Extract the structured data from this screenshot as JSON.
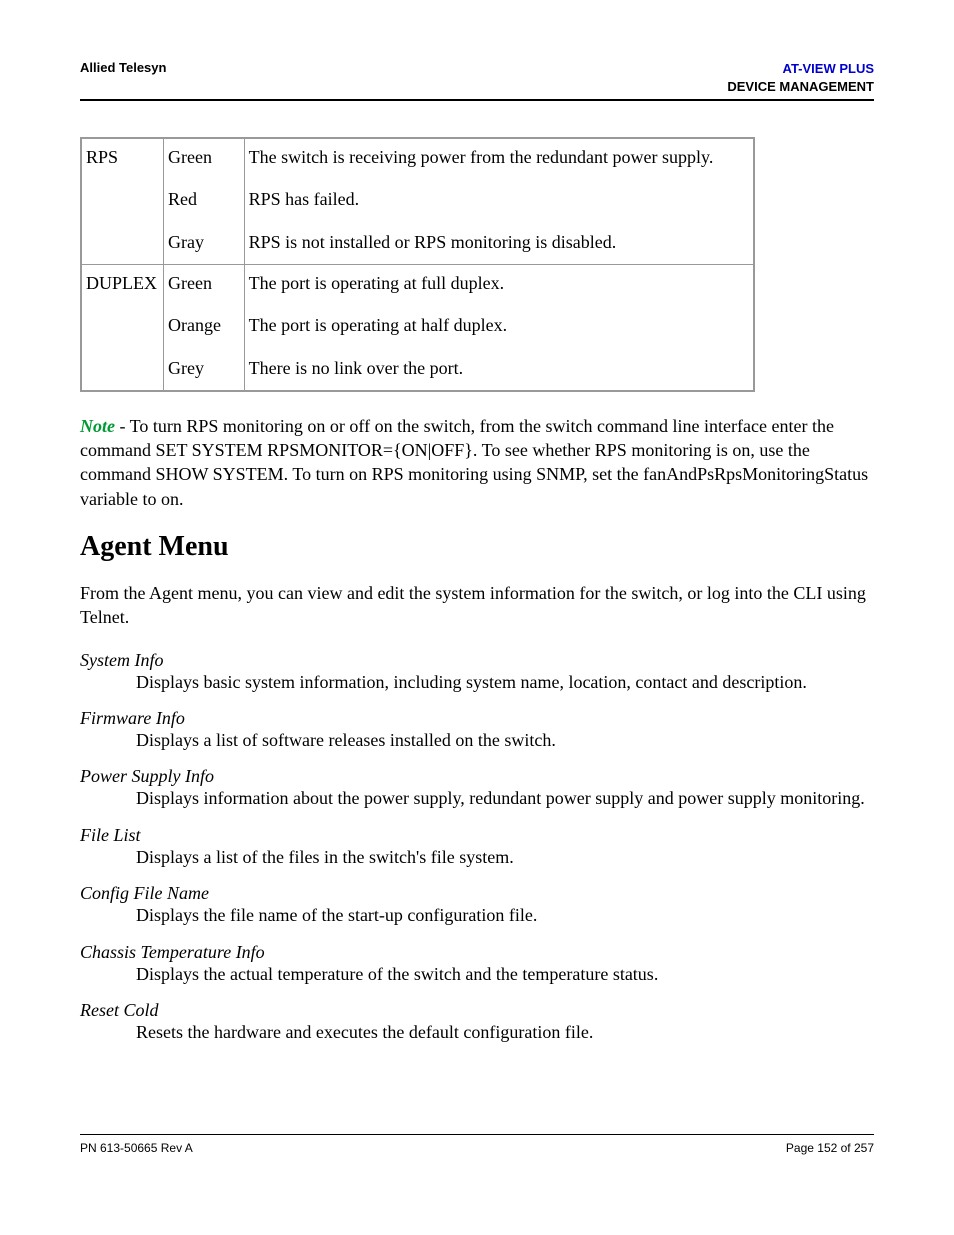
{
  "header": {
    "left": "Allied Telesyn",
    "rightProduct": "AT-VIEW PLUS",
    "rightSection": "DEVICE MANAGEMENT"
  },
  "table": {
    "rows": [
      {
        "name": "RPS",
        "colors": [
          "Green",
          "Red",
          "Gray"
        ],
        "descriptions": [
          "The switch is receiving power from the redundant power supply.",
          "RPS has failed.",
          "RPS is not installed or RPS monitoring is disabled."
        ]
      },
      {
        "name": "DUPLEX",
        "colors": [
          "Green",
          "Orange",
          "Grey"
        ],
        "descriptions": [
          "The port is operating at full duplex.",
          "The port is operating at half duplex.",
          "There is no link over the port."
        ]
      }
    ]
  },
  "note": {
    "label": "Note",
    "text": " - To turn RPS monitoring on or off on the switch, from the switch command line interface enter the command SET SYSTEM RPSMONITOR={ON|OFF}. To see whether RPS monitoring is on, use the command SHOW SYSTEM. To turn on RPS monitoring using SNMP, set the fanAndPsRpsMonitoringStatus variable to on."
  },
  "heading": "Agent Menu",
  "intro": "From the Agent menu, you can view and edit the system information for the switch, or log into the CLI using Telnet.",
  "definitions": [
    {
      "term": "System Info",
      "desc": "Displays basic system information, including system name, location, contact and description."
    },
    {
      "term": "Firmware Info",
      "desc": "Displays a list of software releases installed on the switch."
    },
    {
      "term": "Power Supply Info",
      "desc": "Displays information about the power supply, redundant power supply and power supply monitoring."
    },
    {
      "term": "File List",
      "desc": "Displays a list of the files in the switch's file system."
    },
    {
      "term": "Config File Name",
      "desc": "Displays the file name of the start-up configuration file."
    },
    {
      "term": "Chassis Temperature Info",
      "desc": "Displays the actual temperature of the switch and the temperature status."
    },
    {
      "term": "Reset Cold",
      "desc": "Resets the hardware and executes the default configuration file."
    }
  ],
  "footer": {
    "left": "PN 613-50665 Rev A",
    "right": "Page 152 of 257"
  }
}
